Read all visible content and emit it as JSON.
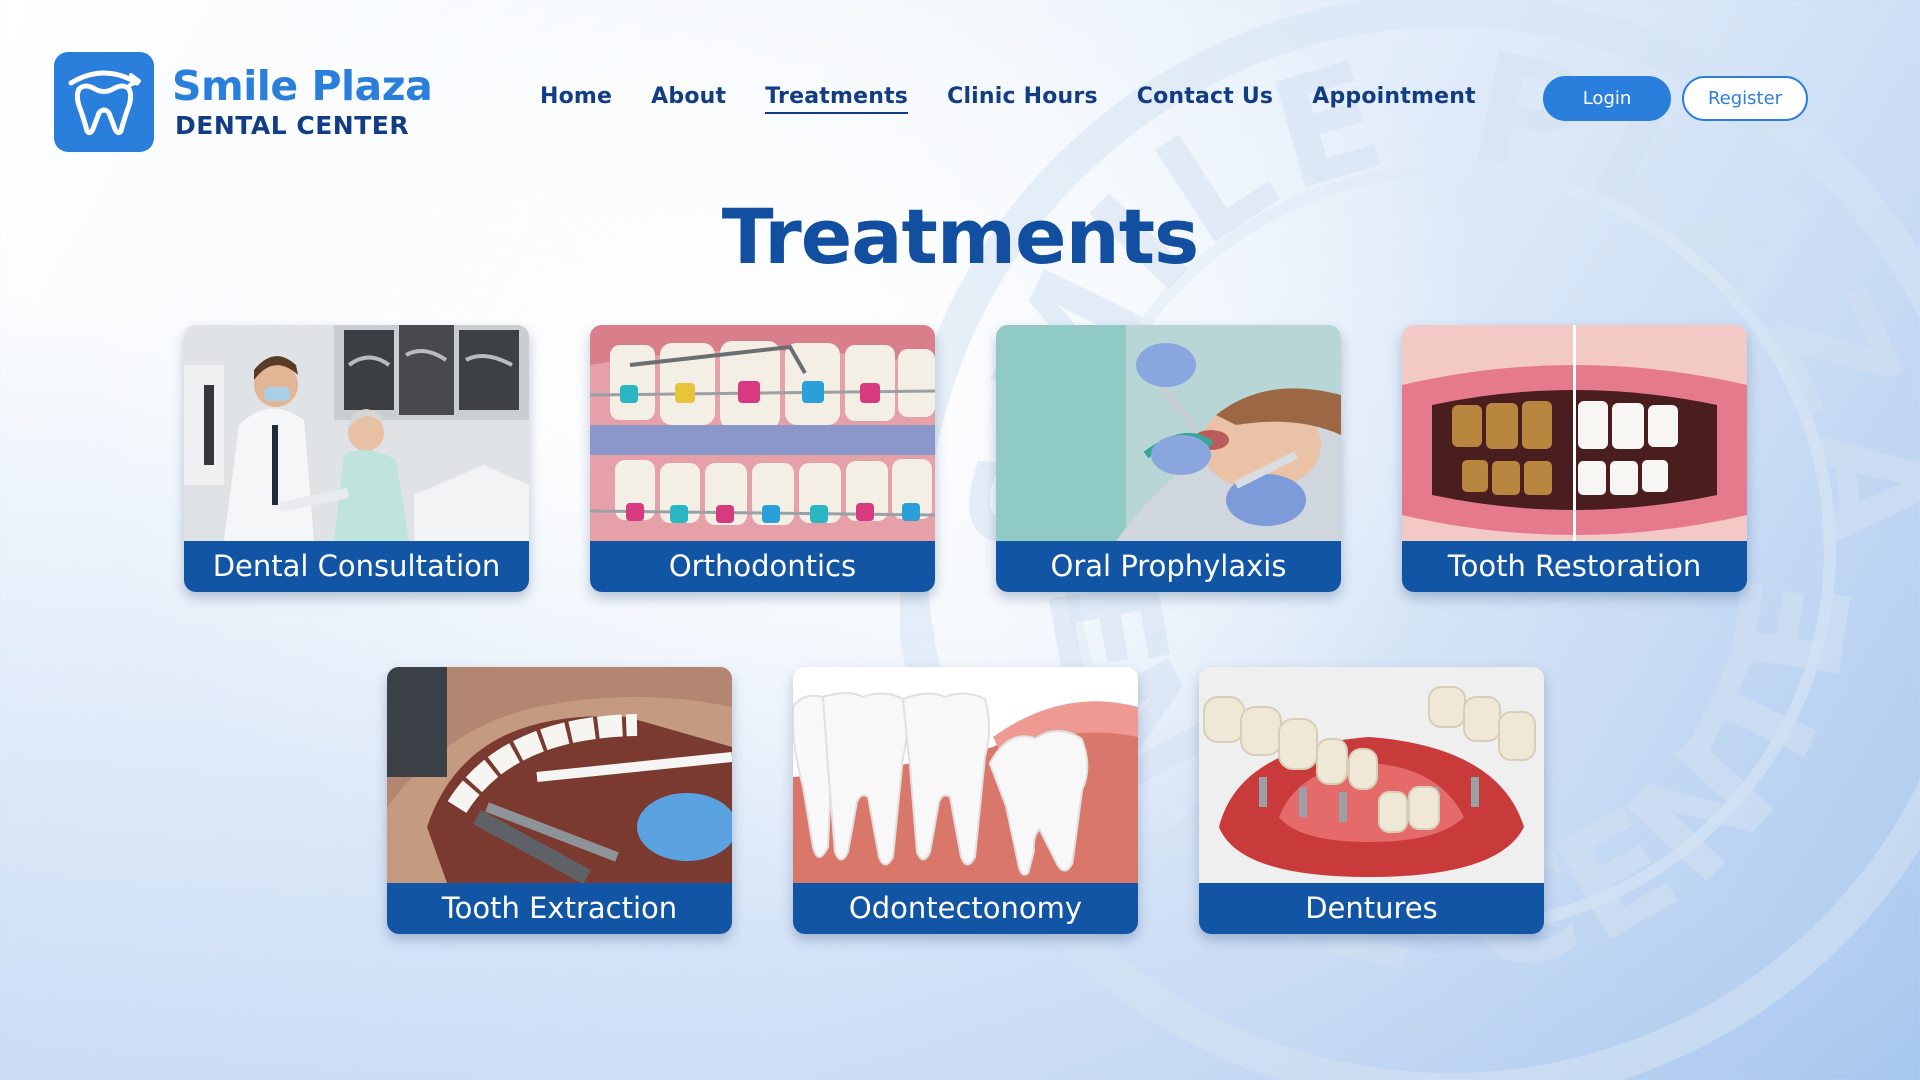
{
  "brand": {
    "name": "Smile Plaza",
    "subtitle": "DENTAL CENTER",
    "watermark_top": "SMILE PLAZA",
    "watermark_bottom": "DENTAL CENTER"
  },
  "nav": {
    "items": [
      {
        "label": "Home"
      },
      {
        "label": "About"
      },
      {
        "label": "Treatments",
        "active": true
      },
      {
        "label": "Clinic Hours"
      },
      {
        "label": "Contact Us"
      },
      {
        "label": "Appointment"
      }
    ]
  },
  "auth": {
    "login": "Login",
    "register": "Register"
  },
  "page": {
    "title": "Treatments"
  },
  "treatments": [
    {
      "label": "Dental Consultation",
      "image": "dentist-consulting-patient"
    },
    {
      "label": "Orthodontics",
      "image": "teeth-with-braces"
    },
    {
      "label": "Oral Prophylaxis",
      "image": "teeth-cleaning-procedure"
    },
    {
      "label": "Tooth Restoration",
      "image": "before-after-teeth-whitening"
    },
    {
      "label": "Tooth Extraction",
      "image": "tooth-extraction-forceps"
    },
    {
      "label": "Odontectonomy",
      "image": "impacted-wisdom-tooth"
    },
    {
      "label": "Dentures",
      "image": "implant-dentures-model"
    }
  ],
  "colors": {
    "primary": "#2a7fdc",
    "navy": "#123c84",
    "title": "#124fa0",
    "card_label_bg": "#1355a5"
  }
}
